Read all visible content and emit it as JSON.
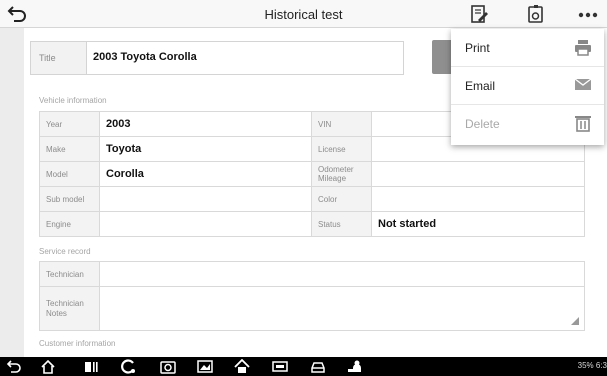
{
  "header": {
    "title": "Historical test"
  },
  "title_field": {
    "label": "Title",
    "value": "2003 Toyota Corolla"
  },
  "vehicle": {
    "section_label": "Vehicle information",
    "rows": [
      {
        "l1": "Year",
        "v1": "2003",
        "l2": "VIN",
        "v2": ""
      },
      {
        "l1": "Make",
        "v1": "Toyota",
        "l2": "License",
        "v2": ""
      },
      {
        "l1": "Model",
        "v1": "Corolla",
        "l2": "Odometer Mileage",
        "v2": ""
      },
      {
        "l1": "Sub model",
        "v1": "",
        "l2": "Color",
        "v2": ""
      },
      {
        "l1": "Engine",
        "v1": "",
        "l2": "Status",
        "v2": "Not started"
      }
    ]
  },
  "service": {
    "section_label": "Service record",
    "technician_label": "Technician",
    "notes_label": "Technician Notes"
  },
  "customer": {
    "section_label": "Customer information"
  },
  "menu": {
    "items": [
      {
        "label": "Print",
        "icon": "printer-icon"
      },
      {
        "label": "Email",
        "icon": "envelope-icon"
      },
      {
        "label": "Delete",
        "icon": "trash-icon"
      }
    ]
  },
  "statusbar": {
    "text": "35% 6:3"
  }
}
